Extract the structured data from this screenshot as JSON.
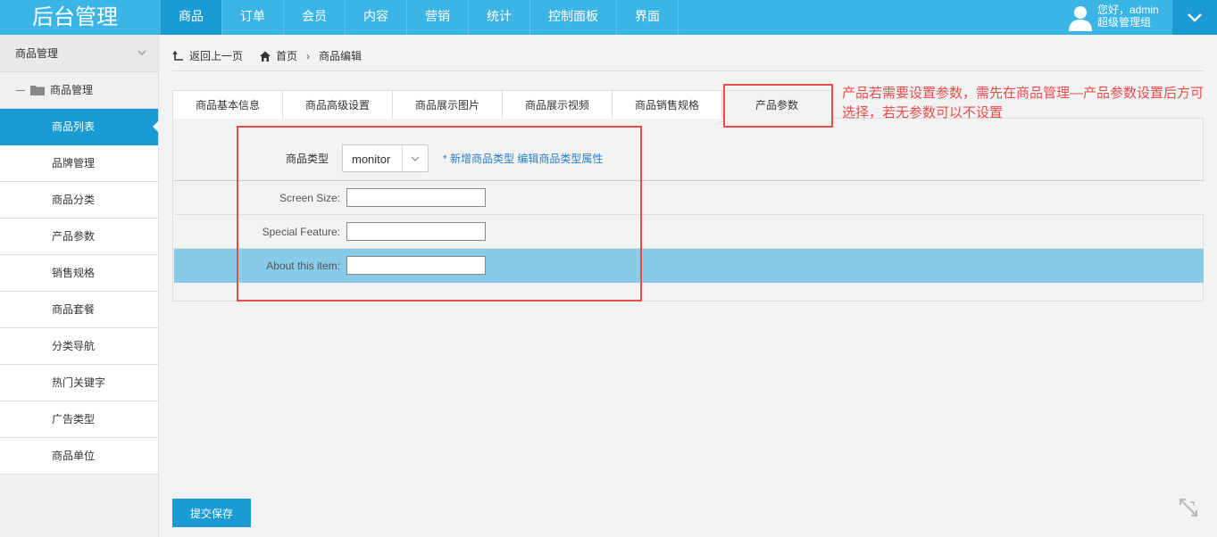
{
  "app": {
    "title": "后台管理"
  },
  "nav": {
    "items": [
      "商品",
      "订单",
      "会员",
      "内容",
      "营销",
      "统计",
      "控制面板",
      "界面"
    ],
    "active_index": 0
  },
  "user": {
    "greeting": "您好，admin",
    "role": "超级管理组"
  },
  "sidebar": {
    "header": "商品管理",
    "group": "商品管理",
    "items": [
      "商品列表",
      "品牌管理",
      "商品分类",
      "产品参数",
      "销售规格",
      "商品套餐",
      "分类导航",
      "热门关键字",
      "广告类型",
      "商品单位"
    ],
    "active_index": 0
  },
  "breadcrumb": {
    "back": "返回上一页",
    "home": "首页",
    "current": "商品编辑"
  },
  "tabs": {
    "items": [
      "商品基本信息",
      "商品高级设置",
      "商品展示图片",
      "商品展示视频",
      "商品销售规格",
      "产品参数"
    ],
    "active_index": 5
  },
  "form": {
    "type_label": "商品类型",
    "type_value": "monitor",
    "star": "*",
    "add_type_link": "新增商品类型",
    "edit_type_link": "编辑商品类型属性",
    "fields": [
      {
        "label": "Screen Size:",
        "value": ""
      },
      {
        "label": "Special Feature:",
        "value": ""
      },
      {
        "label": "About this item:",
        "value": ""
      }
    ]
  },
  "annotation": {
    "note": "产品若需要设置参数，需先在商品管理—产品参数设置后方可选择，若无参数可以不设置"
  },
  "footer": {
    "save_label": "提交保存"
  },
  "colors": {
    "primary": "#3ab5e6",
    "active": "#1a9bd3",
    "highlight_row": "#87cbe8",
    "annotation": "#e84c4c",
    "link": "#2a7fc9"
  }
}
